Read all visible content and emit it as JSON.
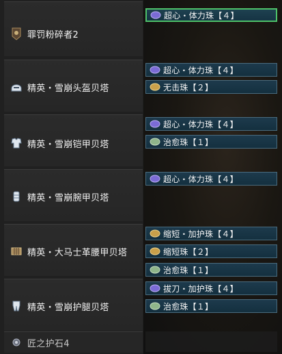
{
  "colors": {
    "slot_bg": "#173545",
    "slot_border": "#4a6b7e",
    "selected_border": "#4ec26a",
    "jewel_purple": "#7b6bd6",
    "jewel_yellow": "#c9a04a",
    "jewel_green": "#8fb58a"
  },
  "equipment": [
    {
      "name": "罪罚粉碎者2",
      "icon": "weapon-icon",
      "decorations": [
        {
          "label": "超心・体力珠【４】",
          "jewel": "purple",
          "selected": true
        }
      ]
    },
    {
      "name": "精英・雪崩头盔贝塔",
      "icon": "helmet-icon",
      "decorations": [
        {
          "label": "超心・体力珠【４】",
          "jewel": "purple"
        },
        {
          "label": "无击珠【２】",
          "jewel": "yellow"
        }
      ]
    },
    {
      "name": "精英・雪崩铠甲贝塔",
      "icon": "chest-armor-icon",
      "decorations": [
        {
          "label": "超心・体力珠【４】",
          "jewel": "purple"
        },
        {
          "label": "治愈珠【１】",
          "jewel": "green"
        }
      ]
    },
    {
      "name": "精英・雪崩腕甲贝塔",
      "icon": "arm-armor-icon",
      "decorations": [
        {
          "label": "超心・体力珠【４】",
          "jewel": "purple"
        }
      ]
    },
    {
      "name": "精英・大马士革腰甲贝塔",
      "icon": "waist-armor-icon",
      "decorations": [
        {
          "label": "缩短・加护珠【４】",
          "jewel": "yellow"
        },
        {
          "label": "缩短珠【２】",
          "jewel": "yellow"
        },
        {
          "label": "治愈珠【１】",
          "jewel": "green"
        }
      ]
    },
    {
      "name": "精英・雪崩护腿贝塔",
      "icon": "leg-armor-icon",
      "decorations": [
        {
          "label": "拔刀・加护珠【４】",
          "jewel": "purple"
        },
        {
          "label": "治愈珠【１】",
          "jewel": "green"
        }
      ]
    }
  ],
  "charm": {
    "name": "匠之护石4",
    "icon": "charm-icon"
  }
}
